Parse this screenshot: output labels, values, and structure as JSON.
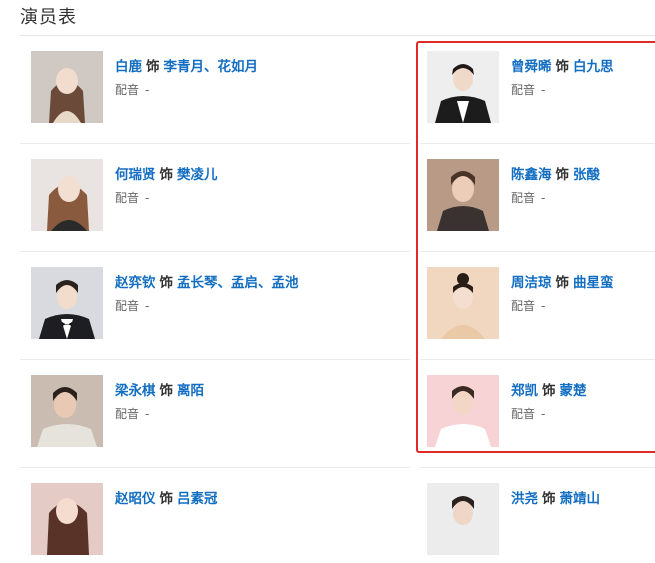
{
  "section": {
    "title": "演员表"
  },
  "role_connector": "饰",
  "dub_label": "配音",
  "dub_value": "-",
  "cast": [
    {
      "actor": "白鹿",
      "role": "李青月、花如月",
      "photo": "portrait-1"
    },
    {
      "actor": "曾舜晞",
      "role": "白九思",
      "photo": "portrait-2"
    },
    {
      "actor": "何瑞贤",
      "role": "樊凌儿",
      "photo": "portrait-3"
    },
    {
      "actor": "陈鑫海",
      "role": "张酸",
      "photo": "portrait-4"
    },
    {
      "actor": "赵弈钦",
      "role": "孟长琴、孟启、孟池",
      "photo": "portrait-5"
    },
    {
      "actor": "周洁琼",
      "role": "曲星蛮",
      "photo": "portrait-6"
    },
    {
      "actor": "梁永棋",
      "role": "离陌",
      "photo": "portrait-7"
    },
    {
      "actor": "郑凯",
      "role": "蒙楚",
      "photo": "portrait-8"
    },
    {
      "actor": "赵昭仪",
      "role": "吕素冠",
      "photo": "portrait-9"
    },
    {
      "actor": "洪尧",
      "role": "萧靖山",
      "photo": "portrait-10"
    }
  ],
  "colors": {
    "link": "#136ec2",
    "highlight_border": "#e02a2a",
    "divider": "#ebebeb"
  }
}
